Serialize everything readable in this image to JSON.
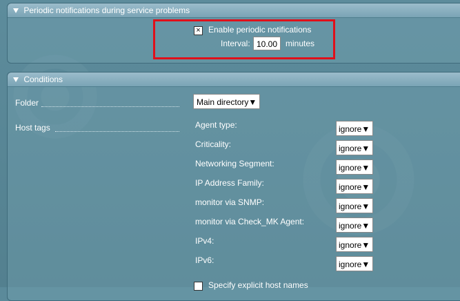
{
  "periodic": {
    "header": "Periodic notifications during service problems",
    "checkbox_mark": "×",
    "enable_label": "Enable periodic notifications",
    "interval_label": "Interval:",
    "interval_value": "10.00",
    "interval_unit": "minutes"
  },
  "conditions": {
    "header": "Conditions",
    "folder_label": "Folder",
    "folder_value": "Main directory",
    "host_tags_label": "Host tags",
    "tags": [
      {
        "label": "Agent type:",
        "value": "ignore"
      },
      {
        "label": "Criticality:",
        "value": "ignore"
      },
      {
        "label": "Networking Segment:",
        "value": "ignore"
      },
      {
        "label": "IP Address Family:",
        "value": "ignore"
      },
      {
        "label": "monitor via SNMP:",
        "value": "ignore"
      },
      {
        "label": "monitor via Check_MK Agent:",
        "value": "ignore"
      },
      {
        "label": "IPv4:",
        "value": "ignore"
      },
      {
        "label": "IPv6:",
        "value": "ignore"
      }
    ],
    "explicit_hosts_label": "Specify explicit host names"
  },
  "colors": {
    "highlight": "#e0101a",
    "background": "#5b8a9a"
  }
}
